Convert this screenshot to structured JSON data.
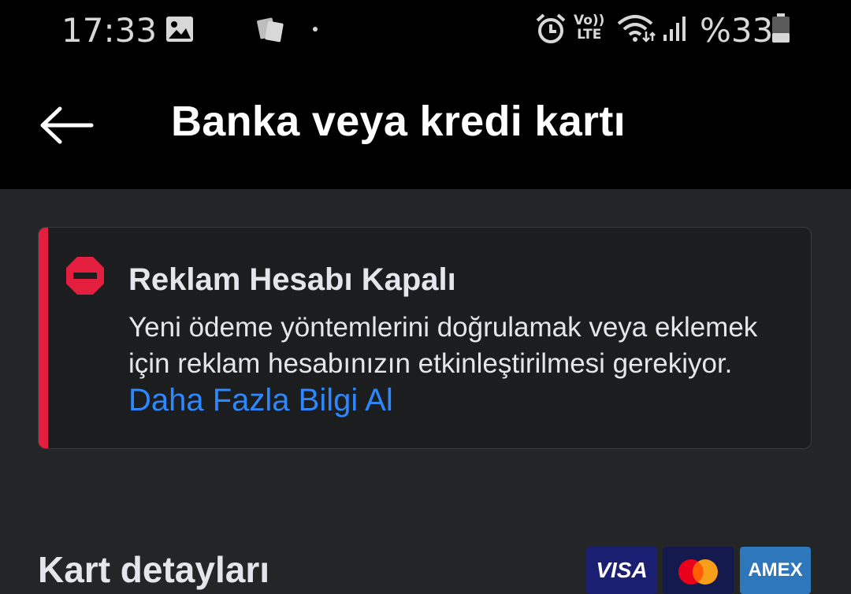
{
  "status_bar": {
    "time": "17:33",
    "network_label_top": "Vo))",
    "network_label_bottom": "LTE",
    "battery_text": "%33",
    "icons": [
      "image-icon",
      "app-notification-icon",
      "dot-icon",
      "alarm-icon",
      "volte-icon",
      "wifi-icon",
      "signal-icon",
      "battery-icon"
    ]
  },
  "header": {
    "title": "Banka veya kredi kartı",
    "back_icon": "back-arrow-icon"
  },
  "alert": {
    "title": "Reklam Hesabı Kapalı",
    "body": "Yeni ödeme yöntemlerini doğrulamak veya eklemek için reklam hesabınızın etkinleştirilmesi gerekiyor. ",
    "link": "Daha Fazla Bilgi Al",
    "icon": "stop-icon",
    "accent_color": "#e41e3f"
  },
  "card_section": {
    "title": "Kart detayları",
    "logos": [
      {
        "name": "visa",
        "label": "VISA"
      },
      {
        "name": "mastercard",
        "label": ""
      },
      {
        "name": "amex",
        "label": "AMEX"
      }
    ]
  },
  "colors": {
    "background": "#242526",
    "header": "#000000",
    "link": "#2d88ff"
  }
}
